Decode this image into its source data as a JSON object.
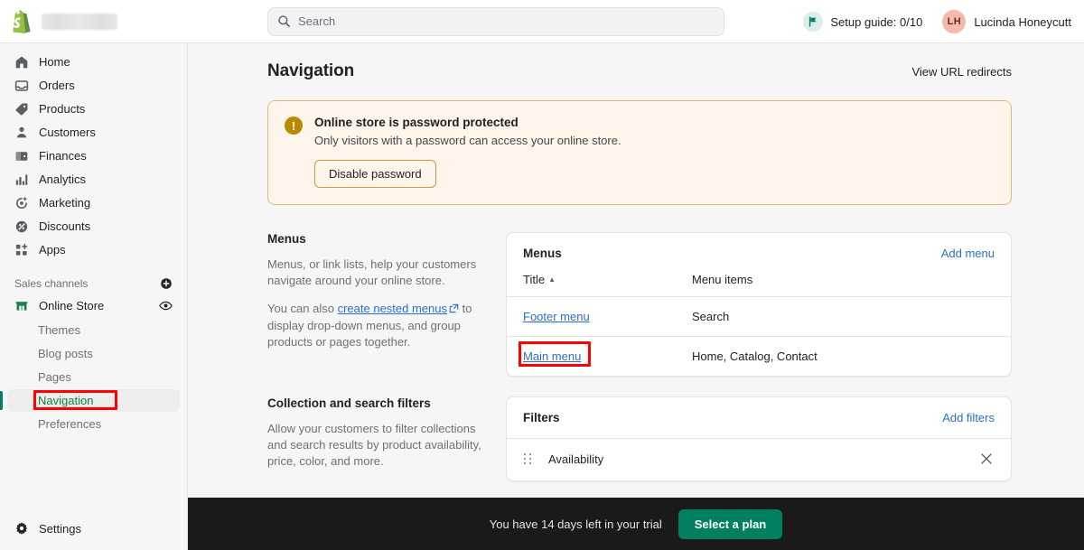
{
  "topbar": {
    "logo_icon": "shopify-logo",
    "store_name_placeholder_blurred": "",
    "search": {
      "placeholder": "Search",
      "icon": "search-icon",
      "value": ""
    },
    "setup_guide": {
      "label": "Setup guide: 0/10",
      "icon": "flag-icon"
    },
    "user": {
      "initials": "LH",
      "name": "Lucinda Honeycutt"
    }
  },
  "sidebar": {
    "items": [
      {
        "label": "Home",
        "icon": "home-icon"
      },
      {
        "label": "Orders",
        "icon": "orders-inbox-icon"
      },
      {
        "label": "Products",
        "icon": "products-tag-icon"
      },
      {
        "label": "Customers",
        "icon": "customers-person-icon"
      },
      {
        "label": "Finances",
        "icon": "finances-wallet-icon"
      },
      {
        "label": "Analytics",
        "icon": "analytics-bars-icon"
      },
      {
        "label": "Marketing",
        "icon": "marketing-target-icon"
      },
      {
        "label": "Discounts",
        "icon": "discounts-percent-icon"
      },
      {
        "label": "Apps",
        "icon": "apps-grid-icon"
      }
    ],
    "sales_channels": {
      "label": "Sales channels",
      "add_icon": "plus-circle-icon"
    },
    "online_store": {
      "label": "Online Store",
      "icon": "storefront-icon",
      "preview_icon": "eye-icon"
    },
    "online_store_sub": [
      {
        "label": "Themes",
        "active": false
      },
      {
        "label": "Blog posts",
        "active": false
      },
      {
        "label": "Pages",
        "active": false
      },
      {
        "label": "Navigation",
        "active": true
      },
      {
        "label": "Preferences",
        "active": false
      }
    ],
    "settings": {
      "label": "Settings",
      "icon": "gear-icon"
    }
  },
  "page": {
    "title": "Navigation",
    "header_action": "View URL redirects"
  },
  "banner": {
    "icon": "alert-exclamation-icon",
    "title": "Online store is password protected",
    "body": "Only visitors with a password can access your online store.",
    "button": "Disable password"
  },
  "menus_section": {
    "heading": "Menus",
    "paragraph1": "Menus, or link lists, help your customers navigate around your online store.",
    "paragraph2_pre": "You can also ",
    "paragraph2_link": "create nested menus",
    "paragraph2_post": " to display drop-down menus, and group products or pages together.",
    "link_external_icon": "external-link-icon",
    "card": {
      "title": "Menus",
      "action": "Add menu",
      "columns": [
        "Title",
        "Menu items"
      ],
      "sort_indicator": "▲",
      "rows": [
        {
          "title": "Footer menu",
          "items": "Search"
        },
        {
          "title": "Main menu",
          "items": "Home, Catalog, Contact"
        }
      ]
    }
  },
  "filters_section": {
    "heading": "Collection and search filters",
    "paragraph": "Allow your customers to filter collections and search results by product availability, price, color, and more.",
    "card": {
      "title": "Filters",
      "action": "Add filters",
      "rows": [
        {
          "name": "Availability",
          "drag_icon": "drag-handle-icon",
          "remove_icon": "close-x-icon"
        }
      ]
    }
  },
  "trial_bar": {
    "text": "You have 14 days left in your trial",
    "button": "Select a plan"
  },
  "colors": {
    "accent_green": "#008060",
    "active_green_text": "#108043",
    "link_blue": "#2c6ecb",
    "banner_bg": "#fff5ea",
    "banner_border": "#e1b878",
    "alert_icon": "#b98900",
    "annotation_red": "#ff0000",
    "trial_bar_bg": "#1a1a1a",
    "avatar_bg": "#f7b9ab"
  }
}
